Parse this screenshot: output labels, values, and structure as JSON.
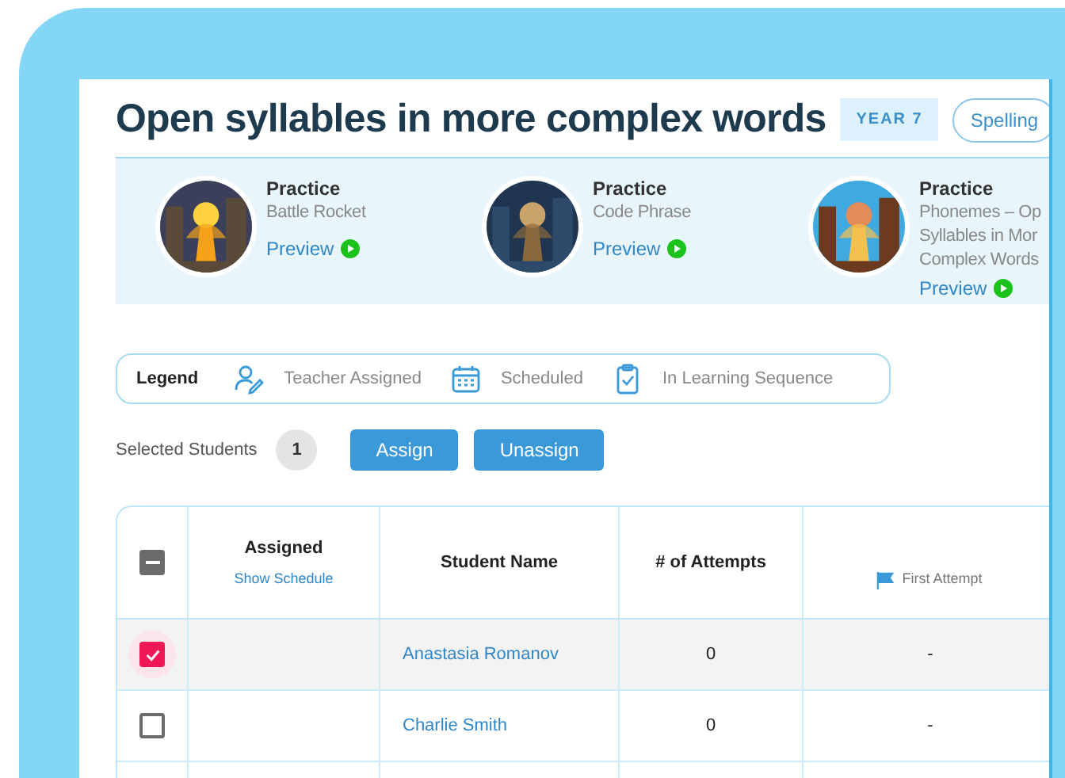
{
  "title": "Open syllables in more complex words",
  "badges": [
    {
      "kind": "year",
      "label": "YEAR 7"
    },
    {
      "kind": "subject",
      "label": "Spelling"
    }
  ],
  "activities": [
    {
      "type": "Practice",
      "name": "Battle Rocket",
      "preview": "Preview"
    },
    {
      "type": "Practice",
      "name": "Code Phrase",
      "preview": "Preview"
    },
    {
      "type": "Practice",
      "name": "Phonemes – Op\nSyllables in Mor\nComplex Words",
      "preview": "Preview"
    }
  ],
  "legend": {
    "title": "Legend",
    "items": [
      {
        "kind": "teacher",
        "label": "Teacher Assigned"
      },
      {
        "kind": "calendar",
        "label": "Scheduled"
      },
      {
        "kind": "clipboard",
        "label": "In Learning Sequence"
      }
    ]
  },
  "selection": {
    "label": "Selected Students",
    "count": "1",
    "buttons": [
      "Assign",
      "Unassign"
    ]
  },
  "table": {
    "select_all": {
      "indeterminate": true
    },
    "columns": [
      {
        "kind": "plain",
        "title": "Assigned",
        "link": "Show Schedule"
      },
      {
        "kind": "plain",
        "title": "Student Name"
      },
      {
        "kind": "plain",
        "title": "# of Attempts"
      },
      {
        "kind": "flag",
        "title": "First Attempt"
      }
    ],
    "rows": [
      {
        "checked": true,
        "student": "Anastasia Romanov",
        "attempts": "0",
        "first_attempt": "-"
      },
      {
        "checked": false,
        "student": "Charlie Smith",
        "attempts": "0",
        "first_attempt": "-"
      }
    ]
  }
}
